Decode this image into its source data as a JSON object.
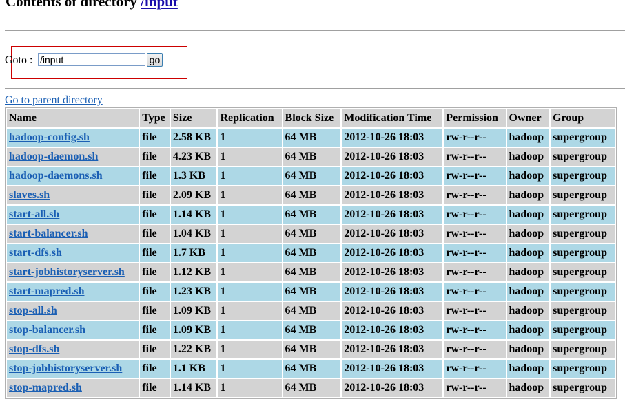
{
  "page": {
    "heading_prefix": "Contents of directory ",
    "heading_link": "/input"
  },
  "goto": {
    "label": "Goto :",
    "value": "/input",
    "button": "go"
  },
  "parent_link": "Go to parent directory",
  "table": {
    "headers": [
      "Name",
      "Type",
      "Size",
      "Replication",
      "Block Size",
      "Modification Time",
      "Permission",
      "Owner",
      "Group"
    ],
    "rows": [
      [
        "hadoop-config.sh",
        "file",
        "2.58 KB",
        "1",
        "64 MB",
        "2012-10-26 18:03",
        "rw-r--r--",
        "hadoop",
        "supergroup"
      ],
      [
        "hadoop-daemon.sh",
        "file",
        "4.23 KB",
        "1",
        "64 MB",
        "2012-10-26 18:03",
        "rw-r--r--",
        "hadoop",
        "supergroup"
      ],
      [
        "hadoop-daemons.sh",
        "file",
        "1.3 KB",
        "1",
        "64 MB",
        "2012-10-26 18:03",
        "rw-r--r--",
        "hadoop",
        "supergroup"
      ],
      [
        "slaves.sh",
        "file",
        "2.09 KB",
        "1",
        "64 MB",
        "2012-10-26 18:03",
        "rw-r--r--",
        "hadoop",
        "supergroup"
      ],
      [
        "start-all.sh",
        "file",
        "1.14 KB",
        "1",
        "64 MB",
        "2012-10-26 18:03",
        "rw-r--r--",
        "hadoop",
        "supergroup"
      ],
      [
        "start-balancer.sh",
        "file",
        "1.04 KB",
        "1",
        "64 MB",
        "2012-10-26 18:03",
        "rw-r--r--",
        "hadoop",
        "supergroup"
      ],
      [
        "start-dfs.sh",
        "file",
        "1.7 KB",
        "1",
        "64 MB",
        "2012-10-26 18:03",
        "rw-r--r--",
        "hadoop",
        "supergroup"
      ],
      [
        "start-jobhistoryserver.sh",
        "file",
        "1.12 KB",
        "1",
        "64 MB",
        "2012-10-26 18:03",
        "rw-r--r--",
        "hadoop",
        "supergroup"
      ],
      [
        "start-mapred.sh",
        "file",
        "1.23 KB",
        "1",
        "64 MB",
        "2012-10-26 18:03",
        "rw-r--r--",
        "hadoop",
        "supergroup"
      ],
      [
        "stop-all.sh",
        "file",
        "1.09 KB",
        "1",
        "64 MB",
        "2012-10-26 18:03",
        "rw-r--r--",
        "hadoop",
        "supergroup"
      ],
      [
        "stop-balancer.sh",
        "file",
        "1.09 KB",
        "1",
        "64 MB",
        "2012-10-26 18:03",
        "rw-r--r--",
        "hadoop",
        "supergroup"
      ],
      [
        "stop-dfs.sh",
        "file",
        "1.22 KB",
        "1",
        "64 MB",
        "2012-10-26 18:03",
        "rw-r--r--",
        "hadoop",
        "supergroup"
      ],
      [
        "stop-jobhistoryserver.sh",
        "file",
        "1.1 KB",
        "1",
        "64 MB",
        "2012-10-26 18:03",
        "rw-r--r--",
        "hadoop",
        "supergroup"
      ],
      [
        "stop-mapred.sh",
        "file",
        "1.14 KB",
        "1",
        "64 MB",
        "2012-10-26 18:03",
        "rw-r--r--",
        "hadoop",
        "supergroup"
      ]
    ]
  },
  "colors": {
    "row_odd": "#add8e6",
    "row_even": "#d3d3d3",
    "header": "#d3d3d3",
    "link": "#1a5fb4",
    "highlight_box": "#cc0000"
  }
}
